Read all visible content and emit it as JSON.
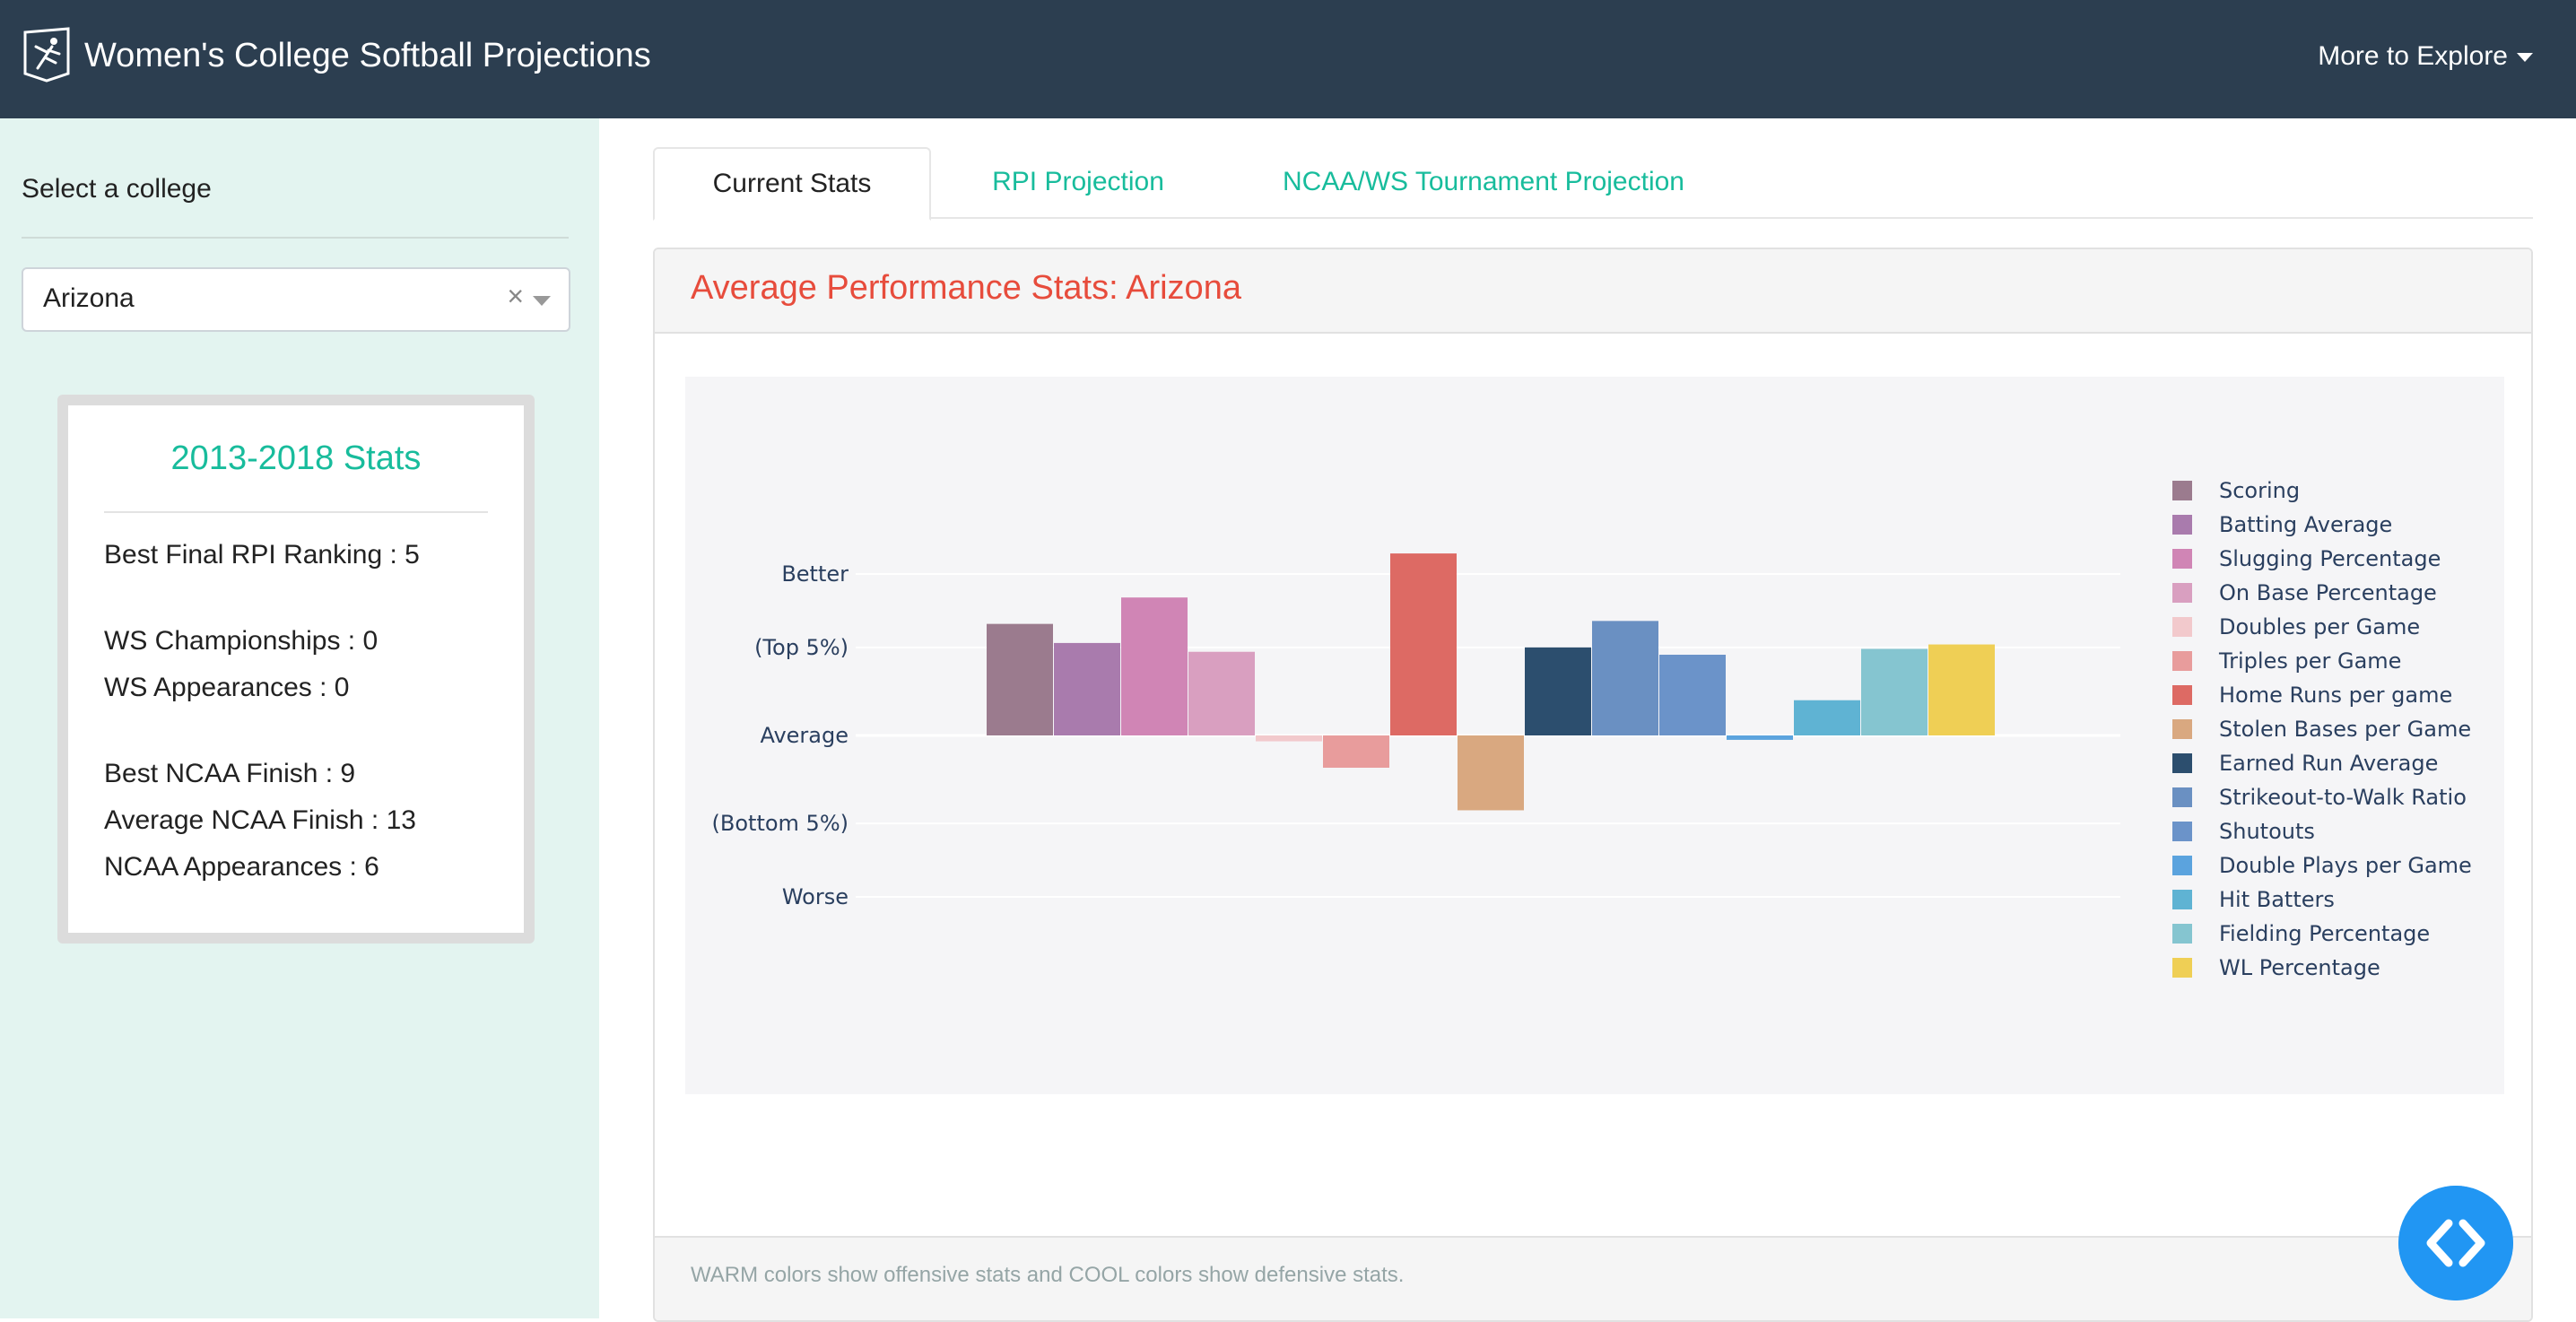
{
  "navbar": {
    "title": "Women's College Softball Projections",
    "more_label": "More to Explore"
  },
  "sidebar": {
    "select_label": "Select a college",
    "selected_college": "Arizona",
    "clear_symbol": "×",
    "card_title": "2013-2018 Stats",
    "stats": [
      "Best Final RPI Ranking : 5",
      "WS Championships : 0",
      "WS Appearances : 0",
      "Best NCAA Finish : 9",
      "Average NCAA Finish : 13",
      "NCAA Appearances : 6"
    ]
  },
  "tabs": [
    "Current Stats",
    "RPI Projection",
    "NCAA/WS Tournament Projection"
  ],
  "panel": {
    "title": "Average Performance Stats: Arizona",
    "footer": "WARM colors show offensive stats and COOL colors show defensive stats."
  },
  "chart_data": {
    "type": "bar",
    "ylim": [
      -1.1,
      1.1
    ],
    "y_tick_labels": [
      {
        "value": 1.1,
        "label": "Better"
      },
      {
        "value": 0.6,
        "label": "(Top 5%)"
      },
      {
        "value": 0,
        "label": "Average"
      },
      {
        "value": -0.6,
        "label": "(Bottom 5%)"
      },
      {
        "value": -1.1,
        "label": "Worse"
      }
    ],
    "grid": true,
    "legend_position": "right",
    "series": [
      {
        "name": "Scoring",
        "value": 0.76,
        "color": "#9b7b8e"
      },
      {
        "name": "Batting Average",
        "value": 0.63,
        "color": "#a97bad"
      },
      {
        "name": "Slugging Percentage",
        "value": 0.94,
        "color": "#d085b5"
      },
      {
        "name": "On Base Percentage",
        "value": 0.57,
        "color": "#d99fc0"
      },
      {
        "name": "Doubles per Game",
        "value": -0.04,
        "color": "#f2c9cc"
      },
      {
        "name": "Triples per Game",
        "value": -0.22,
        "color": "#e89c9c"
      },
      {
        "name": "Home Runs per game",
        "value": 1.24,
        "color": "#dd6a64"
      },
      {
        "name": "Stolen Bases per Game",
        "value": -0.51,
        "color": "#d9a880"
      },
      {
        "name": "Earned Run Average",
        "value": 0.6,
        "color": "#2c4e6e"
      },
      {
        "name": "Strikeout-to-Walk Ratio",
        "value": 0.78,
        "color": "#6a90c2"
      },
      {
        "name": "Shutouts",
        "value": 0.55,
        "color": "#6b93c9"
      },
      {
        "name": "Double Plays per Game",
        "value": -0.03,
        "color": "#5ba3de"
      },
      {
        "name": "Hit Batters",
        "value": 0.24,
        "color": "#5fb3d3"
      },
      {
        "name": "Fielding Percentage",
        "value": 0.59,
        "color": "#85c5d0"
      },
      {
        "name": "WL Percentage",
        "value": 0.62,
        "color": "#efcf55"
      }
    ]
  },
  "colors": {
    "navbar": "#2c3e50",
    "accent": "#18bc9c",
    "panel_title": "#e74c3c",
    "sidebar_bg": "#e3f4f0",
    "fab": "#2196f3"
  },
  "icons": {
    "brand": "softball-player-logo-icon",
    "fab": "code-brackets-icon"
  }
}
